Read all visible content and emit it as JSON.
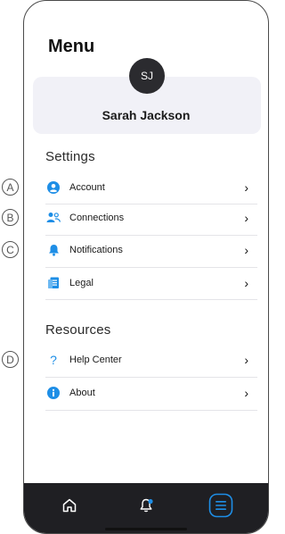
{
  "menu": {
    "title": "Menu"
  },
  "profile": {
    "initials": "SJ",
    "name": "Sarah Jackson"
  },
  "settings": {
    "label": "Settings",
    "items": [
      {
        "marker": "A",
        "label": "Account",
        "icon": "person-circle-icon"
      },
      {
        "marker": "B",
        "label": "Connections",
        "icon": "people-icon"
      },
      {
        "marker": "C",
        "label": "Notifications",
        "icon": "bell-icon"
      },
      {
        "marker": "",
        "label": "Legal",
        "icon": "document-icon"
      }
    ]
  },
  "resources": {
    "label": "Resources",
    "items": [
      {
        "marker": "D",
        "label": "Help Center",
        "icon": "question-icon"
      },
      {
        "marker": "",
        "label": "About",
        "icon": "info-icon"
      }
    ]
  },
  "tabbar": {
    "tabs": [
      "home-icon",
      "bell-icon",
      "menu-icon"
    ],
    "active": "menu-icon"
  },
  "colors": {
    "accent": "#1e8ee6",
    "tabbar": "#1f1f23",
    "card": "#f1f1f7"
  }
}
